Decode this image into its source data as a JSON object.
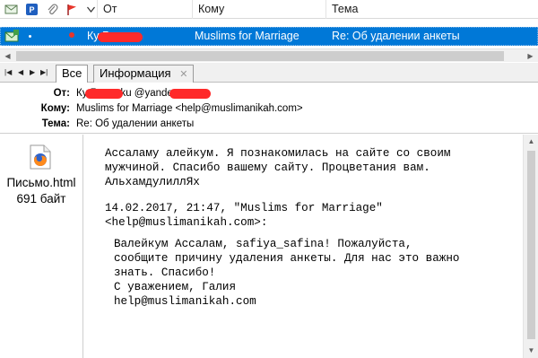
{
  "list": {
    "columns": {
      "from": "От",
      "to": "Кому",
      "subject": "Тема"
    },
    "selected_message": {
      "from": "Ку  Гуля",
      "to": "Muslims for Marriage",
      "subject": "Re: Об удалении анкеты"
    }
  },
  "tabs": [
    {
      "label": "Все"
    },
    {
      "label": "Информация",
      "close": "✕"
    }
  ],
  "headers": {
    "from_label": "От:",
    "from_value": "Ку  Гуля <ku  @yandex.ru>",
    "to_label": "Кому:",
    "to_value": "Muslims for Marriage <help@muslimanikah.com>",
    "subject_label": "Тема:",
    "subject_value": "Re: Об удалении анкеты"
  },
  "attachment": {
    "name": "Письмо.html",
    "size": "691 байт",
    "icon": "firefox-icon"
  },
  "body": {
    "paragraph1": "Ассаламу алейкум. Я познакомилась на сайте со своим\nмужчиной. Спасибо вашему сайту. Процветания вам.\nАльхамдулиллЯх",
    "quote_header": "14.02.2017, 21:47, \"Muslims for Marriage\"\n<help@muslimanikah.com>:",
    "quote": "Валейкум Ассалам, safiya_safina! Пожалуйста,\nсообщите причину удаления анкеты. Для нас это важно\nзнать. Спасибо!\nС уважением, Галия\nhelp@muslimanikah.com"
  },
  "colors": {
    "selection": "#0078d7",
    "redaction": "#ff2a2a",
    "flag": "#e8352b"
  }
}
